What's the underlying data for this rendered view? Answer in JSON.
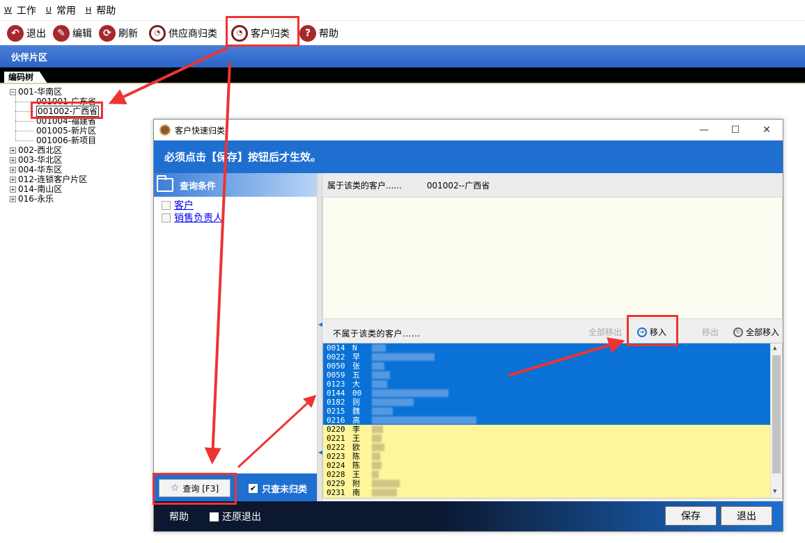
{
  "menubar": {
    "items": [
      {
        "key": "W",
        "label": "工作"
      },
      {
        "key": "U",
        "label": "常用"
      },
      {
        "key": "H",
        "label": "帮助"
      }
    ]
  },
  "toolbar": {
    "exit": "退出",
    "edit": "编辑",
    "refresh": "刷新",
    "supplier_classify": "供应商归类",
    "customer_classify": "客户归类",
    "help": "帮助"
  },
  "area_title": "伙伴片区",
  "tree_tab": "编码树",
  "tree": {
    "root_expanded": "001-华南区",
    "children": [
      "001001-广东省",
      "001002-广西省",
      "001004-福建省",
      "001005-新片区",
      "001006-新项目"
    ],
    "collapsed": [
      "002-西北区",
      "003-华北区",
      "004-华东区",
      "012-连锁客户片区",
      "014-南山区",
      "016-永乐"
    ]
  },
  "dialog": {
    "title": "客户快速归类",
    "banner": "必须点击【保存】按钮后才生效。",
    "query": {
      "header": "查询条件",
      "options": [
        "客户",
        "销售负责人"
      ],
      "query_button": "查询 [F3]",
      "only_unclassified": "只查未归类"
    },
    "belong_label": "属于该类的客户......",
    "belong_code": "001002--广西省",
    "not_belong_label": "不属于该类的客户......",
    "buttons": {
      "remove_all": "全部移出",
      "move_in": "移入",
      "remove": "移出",
      "move_all_in": "全部移入"
    },
    "customers_selected": [
      {
        "code": "0014",
        "name": "N"
      },
      {
        "code": "0022",
        "name": "早"
      },
      {
        "code": "0050",
        "name": "张"
      },
      {
        "code": "0059",
        "name": "五"
      },
      {
        "code": "0123",
        "name": "大"
      },
      {
        "code": "0144",
        "name": "00"
      },
      {
        "code": "0182",
        "name": "则"
      },
      {
        "code": "0215",
        "name": "魏"
      },
      {
        "code": "0216",
        "name": "高"
      }
    ],
    "customers_unselected": [
      {
        "code": "0220",
        "name": "李"
      },
      {
        "code": "0221",
        "name": "王"
      },
      {
        "code": "0222",
        "name": "欧"
      },
      {
        "code": "0223",
        "name": "陈"
      },
      {
        "code": "0224",
        "name": "陈"
      },
      {
        "code": "0228",
        "name": "王"
      },
      {
        "code": "0229",
        "name": "附"
      },
      {
        "code": "0231",
        "name": "南"
      }
    ],
    "footer": {
      "help": "帮助",
      "restore_exit": "还原退出",
      "save": "保存",
      "exit": "退出"
    }
  },
  "colors": {
    "accent_blue": "#1e6fd0",
    "selection_blue": "#0a72d6",
    "unselected_yellow": "#fff59b",
    "toolbar_icon_red": "#a5282d",
    "annotation_red": "#ee3333"
  }
}
